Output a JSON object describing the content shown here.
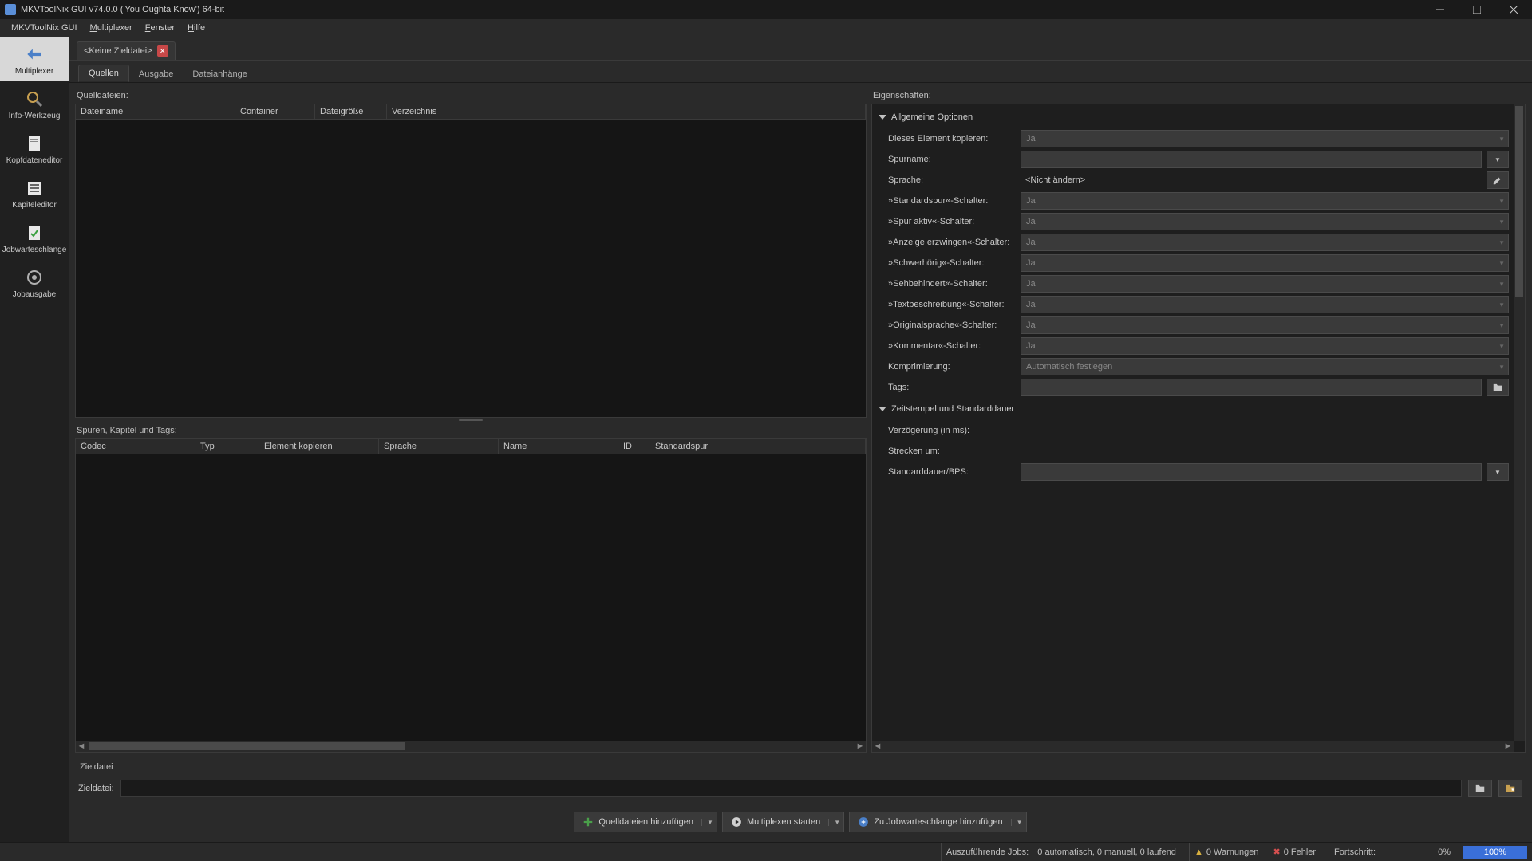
{
  "title": "MKVToolNix GUI v74.0.0 ('You Oughta Know') 64-bit",
  "menu": {
    "app": "MKVToolNix GUI",
    "multiplexer": "Multiplexer",
    "fenster": "Fenster",
    "hilfe": "Hilfe"
  },
  "sidebar": {
    "items": [
      {
        "label": "Multiplexer"
      },
      {
        "label": "Info-Werkzeug"
      },
      {
        "label": "Kopfdateneditor"
      },
      {
        "label": "Kapiteleditor"
      },
      {
        "label": "Jobwarteschlange"
      },
      {
        "label": "Jobausgabe"
      }
    ]
  },
  "doctab": {
    "title": "<Keine Zieldatei>"
  },
  "innertabs": {
    "quellen": "Quellen",
    "ausgabe": "Ausgabe",
    "anhaenge": "Dateianhänge"
  },
  "sources": {
    "label": "Quelldateien:",
    "headers": {
      "dateiname": "Dateiname",
      "container": "Container",
      "dateigroesse": "Dateigröße",
      "verzeichnis": "Verzeichnis"
    }
  },
  "tracks": {
    "label": "Spuren, Kapitel und Tags:",
    "headers": {
      "codec": "Codec",
      "typ": "Typ",
      "kopieren": "Element kopieren",
      "sprache": "Sprache",
      "name": "Name",
      "id": "ID",
      "standardspur": "Standardspur"
    }
  },
  "props": {
    "label": "Eigenschaften:",
    "group_general": "Allgemeine Optionen",
    "rows": {
      "copy": {
        "label": "Dieses Element kopieren:",
        "value": "Ja"
      },
      "spurname": {
        "label": "Spurname:",
        "value": ""
      },
      "sprache": {
        "label": "Sprache:",
        "value": "<Nicht ändern>"
      },
      "standardspur": {
        "label": "»Standardspur«-Schalter:",
        "value": "Ja"
      },
      "aktiv": {
        "label": "»Spur aktiv«-Schalter:",
        "value": "Ja"
      },
      "erzwingen": {
        "label": "»Anzeige erzwingen«-Schalter:",
        "value": "Ja"
      },
      "schwerhoerig": {
        "label": "»Schwerhörig«-Schalter:",
        "value": "Ja"
      },
      "sehbehindert": {
        "label": "»Sehbehindert«-Schalter:",
        "value": "Ja"
      },
      "textbeschr": {
        "label": "»Textbeschreibung«-Schalter:",
        "value": "Ja"
      },
      "originalsprache": {
        "label": "»Originalsprache«-Schalter:",
        "value": "Ja"
      },
      "kommentar": {
        "label": "»Kommentar«-Schalter:",
        "value": "Ja"
      },
      "kompr": {
        "label": "Komprimierung:",
        "value": "Automatisch festlegen"
      },
      "tags": {
        "label": "Tags:",
        "value": ""
      }
    },
    "group_timestamps": "Zeitstempel und Standarddauer",
    "trows": {
      "delay": {
        "label": "Verzögerung (in ms):",
        "value": ""
      },
      "stretch": {
        "label": "Strecken um:",
        "value": ""
      },
      "dur": {
        "label": "Standarddauer/BPS:",
        "value": ""
      }
    }
  },
  "dest": {
    "section": "Zieldatei",
    "label": "Zieldatei:",
    "value": ""
  },
  "actions": {
    "add": "Quelldateien hinzufügen",
    "mux": "Multiplexen starten",
    "queue": "Zu Jobwarteschlange hinzufügen"
  },
  "status": {
    "jobs_label": "Auszuführende Jobs:",
    "jobs_value": "0 automatisch, 0 manuell, 0 laufend",
    "warn": "0 Warnungen",
    "err": "0 Fehler",
    "progress_label": "Fortschritt:",
    "progress_pct": "0%",
    "progress_bar": "100%"
  }
}
